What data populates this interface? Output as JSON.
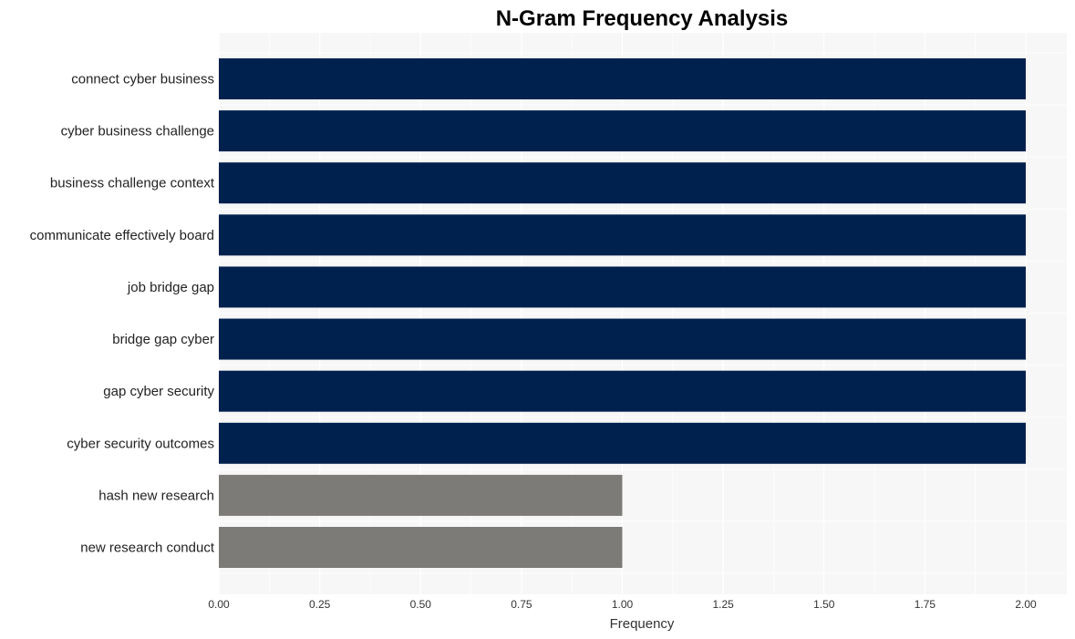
{
  "chart_data": {
    "type": "bar",
    "orientation": "horizontal",
    "title": "N-Gram Frequency Analysis",
    "xlabel": "Frequency",
    "ylabel": "",
    "xlim": [
      0,
      2.1
    ],
    "xticks": [
      0.0,
      0.25,
      0.5,
      0.75,
      1.0,
      1.25,
      1.5,
      1.75,
      2.0
    ],
    "xtick_labels": [
      "0.00",
      "0.25",
      "0.50",
      "0.75",
      "1.00",
      "1.25",
      "1.50",
      "1.75",
      "2.00"
    ],
    "grid": true,
    "categories": [
      "connect cyber business",
      "cyber business challenge",
      "business challenge context",
      "communicate effectively board",
      "job bridge gap",
      "bridge gap cyber",
      "gap cyber security",
      "cyber security outcomes",
      "hash new research",
      "new research conduct"
    ],
    "values": [
      2,
      2,
      2,
      2,
      2,
      2,
      2,
      2,
      1,
      1
    ],
    "colors": {
      "high": "#00214e",
      "low": "#7c7b77",
      "plot_background": "#f7f7f7",
      "grid": "#ffffff"
    }
  }
}
